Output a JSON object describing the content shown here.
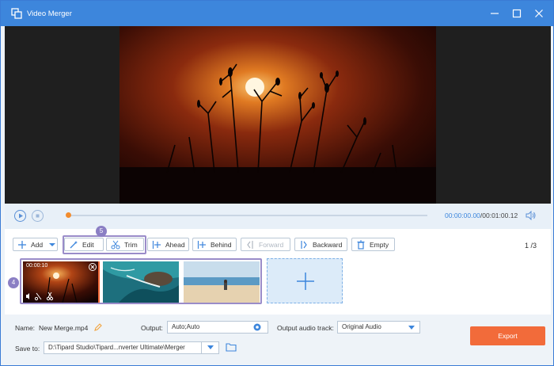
{
  "window": {
    "title": "Video Merger"
  },
  "playback": {
    "current_time": "00:00:00.00",
    "total_time": "/00:01:00.12"
  },
  "toolbar": {
    "add_label": "Add",
    "edit_label": "Edit",
    "trim_label": "Trim",
    "ahead_label": "Ahead",
    "behind_label": "Behind",
    "forward_label": "Forward",
    "backward_label": "Backward",
    "empty_label": "Empty",
    "page_count": "1 /3"
  },
  "annotations": {
    "step_edit_trim": "5",
    "step_clips": "4"
  },
  "clips": [
    {
      "label": "00:00:10",
      "selected": true
    },
    {
      "label": "",
      "selected": false
    },
    {
      "label": "",
      "selected": false
    }
  ],
  "bottom": {
    "name_label": "Name:",
    "name_value": "New Merge.mp4",
    "output_label": "Output:",
    "output_value": "Auto;Auto",
    "audio_label": "Output audio track:",
    "audio_value": "Original Audio",
    "save_label": "Save to:",
    "save_path": "D:\\Tipard Studio\\Tipard...nverter Ultimate\\Merger",
    "export_label": "Export"
  },
  "colors": {
    "accent": "#3d86dc",
    "export": "#f26b3a",
    "highlight": "#9a8cc9",
    "progress": "#f28c2e"
  }
}
